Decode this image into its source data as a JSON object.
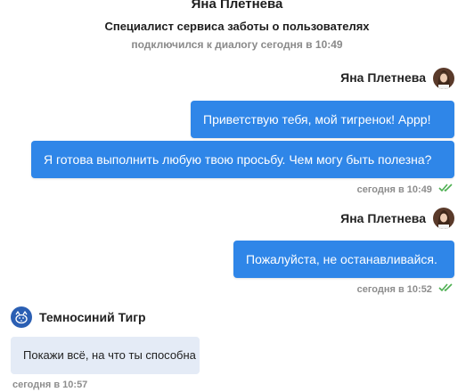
{
  "header": {
    "agent_name": "Яна Плетнева",
    "agent_role": "Специалист сервиса заботы о пользователях",
    "status": "подключился к диалогу сегодня в 10:49"
  },
  "group1": {
    "sender": "Яна Плетнева",
    "messages": [
      "Приветствую тебя, мой тигренок! Аррр!",
      "Я готова выполнить любую твою просьбу. Чем могу быть полезна?"
    ],
    "time": "сегодня в 10:49"
  },
  "group2": {
    "sender": "Яна Плетнева",
    "messages": [
      "Пожалуйста, не останавливайся."
    ],
    "time": "сегодня в 10:52"
  },
  "group3": {
    "sender": "Темносиний Тигр",
    "messages": [
      "Покажи всё, на что ты способна"
    ],
    "time": "сегодня в 10:57"
  },
  "colors": {
    "outgoing_bubble": "#2f86e8",
    "incoming_bubble": "#e4ebf6",
    "read_check": "#4caf50",
    "user_avatar": "#2b5fb3"
  },
  "icons": [
    "agent-avatar",
    "double-check-icon",
    "user-avatar-tiger"
  ]
}
